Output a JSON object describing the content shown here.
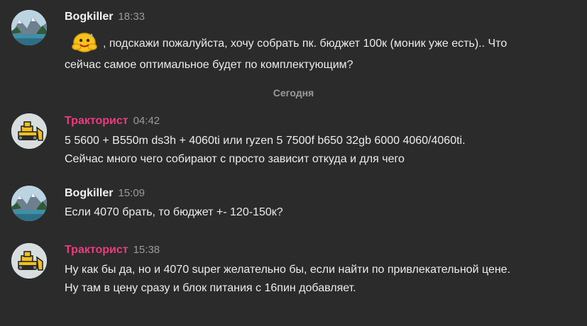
{
  "messages": [
    {
      "author": "Bogkiller",
      "time": "18:33",
      "lines": [
        ", подскажи пожалуйста, хочу собрать пк. бюджет 100к (моник уже есть).. Что",
        "сейчас самое оптимальное будет по комплектующим?"
      ]
    },
    {
      "author": "Тракторист",
      "time": "04:42",
      "lines": [
        "5 5600 + B550m ds3h + 4060ti или ryzen 5 7500f b650 32gb 6000 4060/4060ti.",
        "Сейчас много чего собирают с просто зависит откуда и для чего"
      ]
    },
    {
      "author": "Bogkiller",
      "time": "15:09",
      "lines": [
        "Если 4070 брать, то бюджет +- 120-150к?"
      ]
    },
    {
      "author": "Тракторист",
      "time": "15:38",
      "lines": [
        "Ну как бы да, но и 4070 super желательно бы, если найти по привлекательной цене.",
        "Ну там в цену сразу и блок питания с 16пин добавляет."
      ]
    }
  ],
  "divider": "Сегодня",
  "colors": {
    "background": "#2b2b2b",
    "author_default": "#f2f2f2",
    "author_accent": "#ec3b7e",
    "timestamp": "#9a9a9a"
  },
  "icons": {
    "bogkiller_avatar": "mountain-lake-avatar",
    "traktorist_avatar": "bulldozer-avatar",
    "emoji": "sweating-smile-emoji"
  }
}
